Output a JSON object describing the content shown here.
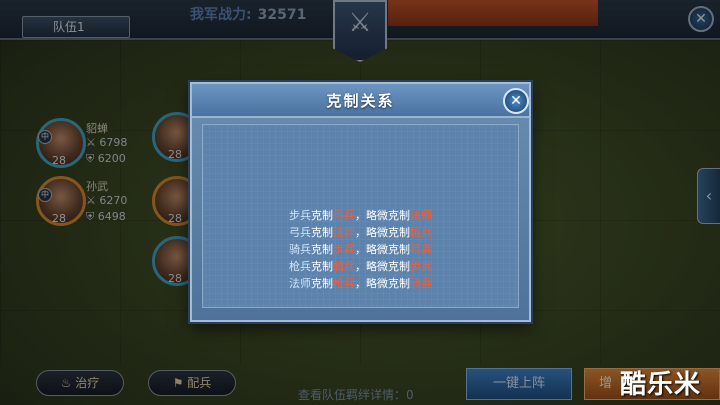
{
  "topbar": {
    "team_tab": "队伍1",
    "power_label": "我军战力:",
    "power_value": "32571",
    "close_glyph": "✕"
  },
  "heroes": [
    {
      "name": "貂蝉",
      "atk": "6798",
      "def": "6200",
      "level": "28",
      "class_glyph": "中"
    },
    {
      "name": "孙武",
      "atk": "6270",
      "def": "6498",
      "level": "28",
      "class_glyph": "中"
    },
    {
      "name": "",
      "atk": "",
      "def": "",
      "level": "28",
      "class_glyph": ""
    },
    {
      "name": "",
      "atk": "",
      "def": "",
      "level": "28",
      "class_glyph": ""
    },
    {
      "name": "",
      "atk": "",
      "def": "",
      "level": "28",
      "class_glyph": ""
    }
  ],
  "modal": {
    "title": "克制关系",
    "close_glyph": "✕",
    "relations": [
      {
        "unit": "步兵",
        "strong_word": "克制",
        "strong_vs": "弓兵",
        "weak_word": "，略微克制",
        "weak_vs": "法师"
      },
      {
        "unit": "弓兵",
        "strong_word": "克制",
        "strong_vs": "法师",
        "weak_word": "，略微克制",
        "weak_vs": "枪兵"
      },
      {
        "unit": "骑兵",
        "strong_word": "克制",
        "strong_vs": "步兵",
        "weak_word": "，略微克制",
        "weak_vs": "弓兵"
      },
      {
        "unit": "枪兵",
        "strong_word": "克制",
        "strong_vs": "骑兵",
        "weak_word": "，略微克制",
        "weak_vs": "步兵"
      },
      {
        "unit": "法师",
        "strong_word": "克制",
        "strong_vs": "枪兵",
        "weak_word": "，略微克制",
        "weak_vs": "骑兵"
      }
    ]
  },
  "bottom": {
    "heal_label": "治疗",
    "assign_label": "配兵",
    "bond_info": "查看队伍羁绊详情：0",
    "deploy_label": "一键上阵",
    "orange_label": "增",
    "watermark": "酷乐米"
  },
  "icons": {
    "side_tab": "chevron-left-icon",
    "emblem": "crossed-swords-icon"
  },
  "colors": {
    "counter_red": "#ff5a2a",
    "unit_blue": "#cfe6ff",
    "modal_blue": "#5d82ab"
  }
}
